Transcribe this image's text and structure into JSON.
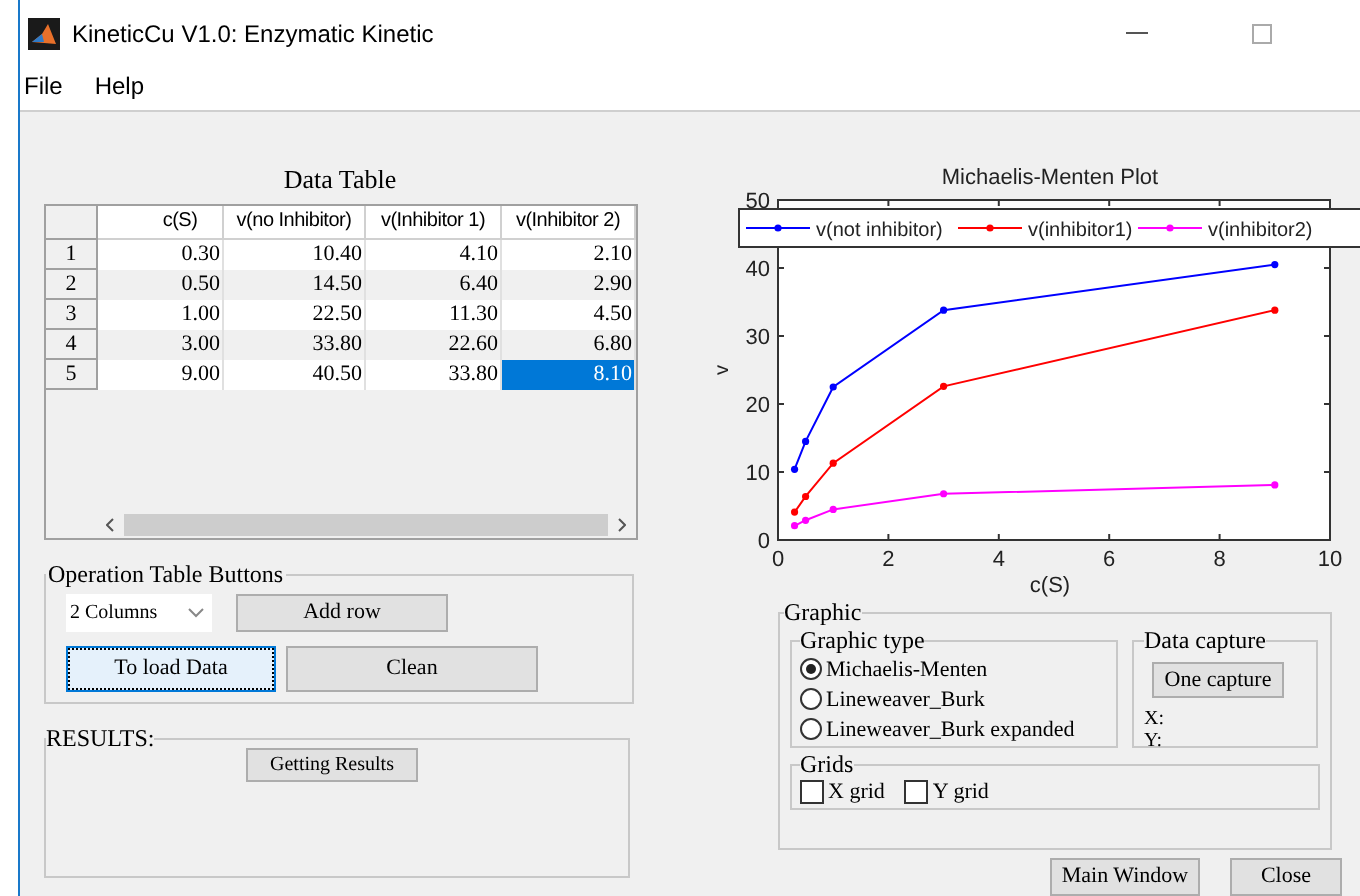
{
  "window": {
    "title": "KineticCu V1.0: Enzymatic Kinetic"
  },
  "menu": [
    "File",
    "Help"
  ],
  "data_table": {
    "title": "Data Table",
    "columns": [
      "c(S)",
      "v(no Inhibitor)",
      "v(Inhibitor 1)",
      "v(Inhibitor 2)"
    ],
    "rows": [
      {
        "header": "1",
        "cells": [
          {
            "text": "0.30",
            "selected": false
          },
          {
            "text": "10.40",
            "selected": false
          },
          {
            "text": "4.10",
            "selected": false
          },
          {
            "text": "2.10",
            "selected": false
          }
        ]
      },
      {
        "header": "2",
        "cells": [
          {
            "text": "0.50",
            "selected": false
          },
          {
            "text": "14.50",
            "selected": false
          },
          {
            "text": "6.40",
            "selected": false
          },
          {
            "text": "2.90",
            "selected": false
          }
        ]
      },
      {
        "header": "3",
        "cells": [
          {
            "text": "1.00",
            "selected": false
          },
          {
            "text": "22.50",
            "selected": false
          },
          {
            "text": "11.30",
            "selected": false
          },
          {
            "text": "4.50",
            "selected": false
          }
        ]
      },
      {
        "header": "4",
        "cells": [
          {
            "text": "3.00",
            "selected": false
          },
          {
            "text": "33.80",
            "selected": false
          },
          {
            "text": "22.60",
            "selected": false
          },
          {
            "text": "6.80",
            "selected": false
          }
        ]
      },
      {
        "header": "5",
        "cells": [
          {
            "text": "9.00",
            "selected": false
          },
          {
            "text": "40.50",
            "selected": false
          },
          {
            "text": "33.80",
            "selected": false
          },
          {
            "text": "8.10",
            "selected": true
          }
        ]
      }
    ]
  },
  "operation_panel": {
    "title": "Operation Table Buttons",
    "dropdown": {
      "value": "2 Columns"
    },
    "add_button": {
      "label": "Add row",
      "focused": false
    },
    "load_button": {
      "label": "To load Data",
      "focused": true
    },
    "clean_button": {
      "label": "Clean",
      "focused": false
    }
  },
  "results_panel": {
    "title": "RESULTS:",
    "button": "Getting Results"
  },
  "plot": {
    "chart_data": {
      "type": "line",
      "title": "Michaelis-Menten Plot",
      "xlabel": "c(S)",
      "ylabel": "v",
      "x": [
        0.3,
        0.5,
        1,
        3,
        9
      ],
      "legend": true,
      "xlim": [
        0,
        10
      ],
      "ylim": [
        0,
        50
      ],
      "xticks": [
        0,
        2,
        4,
        6,
        8,
        10
      ],
      "yticks": [
        0,
        10,
        20,
        30,
        40,
        50
      ],
      "series": [
        {
          "name": "v(not inhibitor)",
          "color": "#0000ff",
          "marker": "dot",
          "values": [
            10.4,
            14.5,
            22.5,
            33.8,
            40.5
          ]
        },
        {
          "name": "v(inhibitor1)",
          "color": "#ff0000",
          "marker": "dot",
          "values": [
            4.1,
            6.4,
            11.3,
            22.6,
            33.8
          ]
        },
        {
          "name": "v(inhibitor2)",
          "color": "#ff00ff",
          "marker": "dot",
          "values": [
            2.1,
            2.9,
            4.5,
            6.8,
            8.1
          ]
        }
      ]
    }
  },
  "graphic_panel": {
    "title": "Graphic",
    "graphic_type": {
      "title": "Graphic type",
      "options": [
        {
          "label": "Michaelis-Menten",
          "selected": true
        },
        {
          "label": "Lineweaver_Burk",
          "selected": false
        },
        {
          "label": "Lineweaver_Burk expanded",
          "selected": false
        }
      ]
    },
    "data_capture": {
      "title": "Data capture",
      "button": "One capture",
      "x_label": "X:",
      "y_label": "Y:"
    },
    "grids": {
      "title": "Grids",
      "options": [
        {
          "label": "X grid",
          "checked": false
        },
        {
          "label": "Y grid",
          "checked": false
        }
      ]
    }
  },
  "buttons": [
    "Main Window",
    "Close"
  ]
}
